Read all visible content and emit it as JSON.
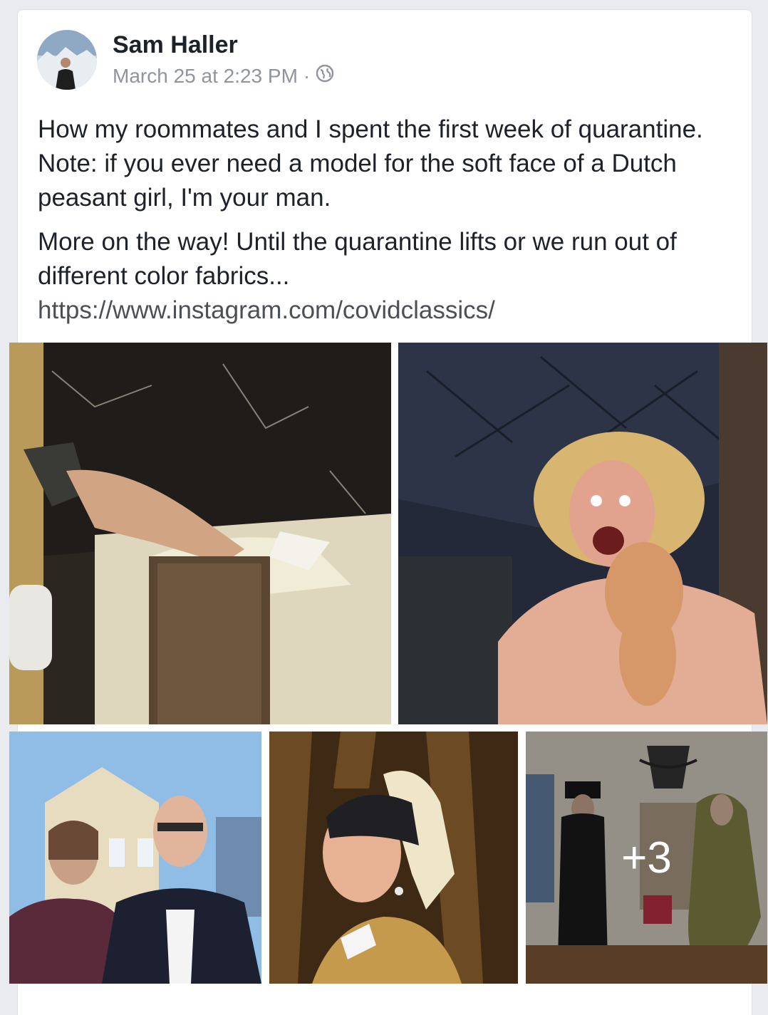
{
  "post": {
    "author": "Sam Haller",
    "timestamp": "March 25 at 2:23 PM",
    "separator": "·",
    "privacy_icon": "globe-icon",
    "paragraph1": "How my roommates and I spent the first week of quarantine. Note: if you ever need a model for the soft face of a Dutch peasant girl, I'm your man.",
    "paragraph2": "More on the way! Until the quarantine lifts or we run out of different color fabrics...",
    "link": "https://www.instagram.com/covidclassics/"
  },
  "photos": {
    "more_count": "+3"
  },
  "colors": {
    "text": "#1d2129",
    "meta": "#90949c",
    "link": "#4b4f56"
  }
}
